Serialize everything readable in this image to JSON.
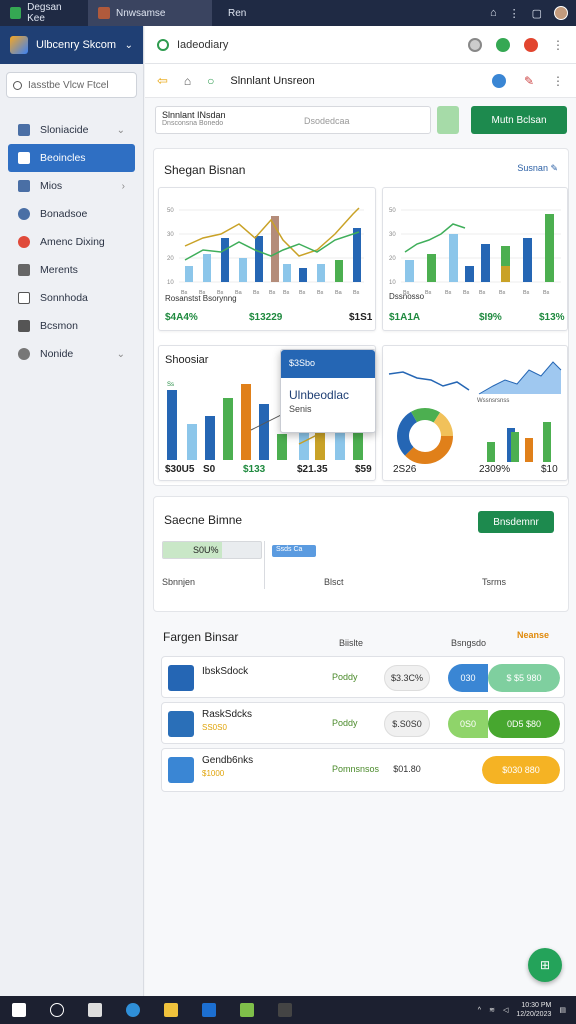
{
  "titlebar": {
    "tabs": [
      "Degsan Kee",
      "Nnwsamse",
      "Ren"
    ]
  },
  "sidebar": {
    "brand": "Ulbcenry Skcom",
    "search_placeholder": "Iasstbe Vlcw Ftcel",
    "items": [
      {
        "label": "Sloniacide",
        "has_chevron": true
      },
      {
        "label": "Beoincles",
        "active": true
      },
      {
        "label": "Mios",
        "has_chevron": true
      },
      {
        "label": "Bonadsoe"
      },
      {
        "label": "Amenc Dixing"
      },
      {
        "label": "Merents"
      },
      {
        "label": "Sonnhoda"
      },
      {
        "label": "Bcsmon"
      },
      {
        "label": "Nonide",
        "has_chevron": true
      }
    ]
  },
  "header": {
    "title": "Iadeodiary"
  },
  "toolbar": {
    "title": "Slnnlant Unsreon"
  },
  "filter": {
    "title": "Slnnlant INsdan",
    "subtitle": "Dnsconsna Bonedo",
    "placeholder": "Dsodedcaa",
    "button": "Mutn Bclsan"
  },
  "analytics": {
    "title": "Shegan Bisnan",
    "link": "Susnan ✎",
    "card1": {
      "caption": "Rosanstst Bsorynng",
      "stats": [
        "$4A4%",
        "$13229",
        "$1S1"
      ]
    },
    "card2": {
      "caption": "Dssnosso",
      "stats": [
        "$1A1A",
        "$I9%",
        "$13%"
      ]
    },
    "card3": {
      "title": "Shoosiar",
      "label": "Ss",
      "stats": [
        "$30U5",
        "S0",
        "$133",
        "$21.35",
        "$59"
      ]
    },
    "card4": {
      "caption": "Wssnsrsnss",
      "stats": [
        "2S26",
        "2309%",
        "$10"
      ]
    },
    "popup": {
      "head": "$3Sbo",
      "main": "Ulnbeodlac",
      "sub": "Senis"
    }
  },
  "section2": {
    "title": "Saecne Bimne",
    "button": "Bnsdemnr",
    "progress": {
      "label": "S0U%",
      "value": 0.6
    },
    "tag": "Ssds Ca",
    "columns": [
      "Sbnnjen",
      "Blsct",
      "Tsrms"
    ]
  },
  "table": {
    "title": "Fargen Binsar",
    "columns": [
      "Biislte",
      "Bsngsdo",
      "Neanse"
    ],
    "rows": [
      {
        "name": "IbskSdock",
        "sub": "",
        "status": "Poddy",
        "amount": "$3.3C%",
        "pill_left": "030",
        "pill_right": "$ $5 980",
        "pill_left_color": "#3a86d4",
        "pill_right_color": "#7fcf9f"
      },
      {
        "name": "RaskSdcks",
        "sub": "SS0S0",
        "status": "Poddy",
        "amount": "$.S0S0",
        "pill_left": "0S0",
        "pill_right": "0D5 $80",
        "pill_left_color": "#8fd46a",
        "pill_right_color": "#47a72f"
      },
      {
        "name": "Gendb6nks",
        "sub": "$1000",
        "status": "Pomnsnsos",
        "amount": "$01.80",
        "pill_left": "",
        "pill_right": "$030 880",
        "pill_left_color": "#f5b324",
        "pill_right_color": "#f5b324"
      }
    ]
  },
  "fab_label": "⊞",
  "taskbar": {
    "clock_line1": "10:30 PM",
    "clock_line2": "12/20/2023"
  },
  "colors": {
    "accent": "#2f6fc3",
    "success": "#1d8a4e",
    "titlebar": "#1f2a44",
    "sidebar_brand": "#1f3f74"
  }
}
